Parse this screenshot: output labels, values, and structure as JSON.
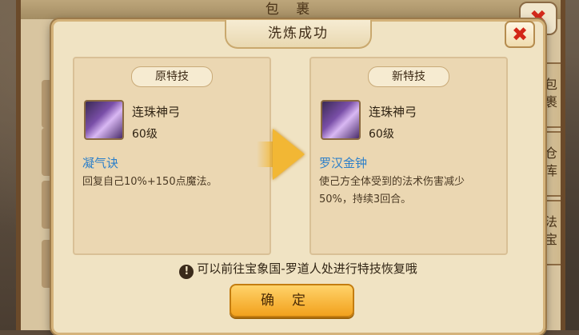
{
  "bag": {
    "title": "包 裹",
    "close": "✖",
    "tabs": [
      "包裹",
      "仓库",
      "法宝"
    ]
  },
  "dialog": {
    "title": "洗炼成功",
    "close": "✖",
    "left": {
      "label": "原特技",
      "item_name": "连珠神弓",
      "item_level": "60级",
      "skill_name": "凝气诀",
      "skill_desc": "回复自己10%+150点魔法。"
    },
    "right": {
      "label": "新特技",
      "item_name": "连珠神弓",
      "item_level": "60级",
      "skill_name": "罗汉金钟",
      "skill_desc": "使己方全体受到的法术伤害减少50%，持续3回合。"
    },
    "notice_icon": "!",
    "notice": "可以前往宝象国-罗道人处进行特技恢复哦",
    "confirm": "确定"
  }
}
